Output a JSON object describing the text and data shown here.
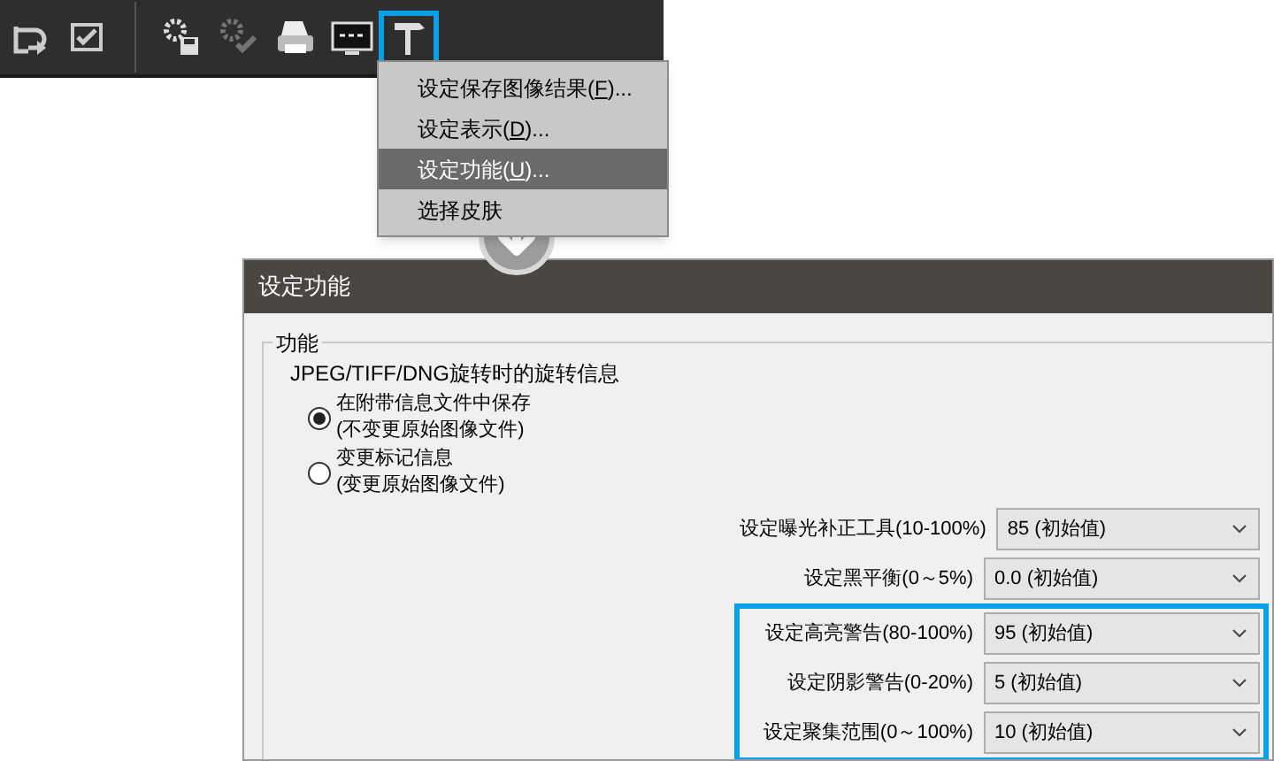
{
  "toolbar": {
    "items": [
      {
        "kind": "rotate",
        "disabled": false
      },
      {
        "kind": "check",
        "disabled": false
      },
      {
        "kind": "divider"
      },
      {
        "kind": "gear-save",
        "disabled": false
      },
      {
        "kind": "gear-check",
        "disabled": true
      },
      {
        "kind": "printer",
        "disabled": false
      },
      {
        "kind": "monitor",
        "disabled": false
      }
    ],
    "framed_items": [
      {
        "kind": "hammer",
        "disabled": false
      }
    ]
  },
  "menu": {
    "items": [
      {
        "before": "设定保存图像结果(",
        "mnemonic": "F",
        "after": ")...",
        "selected": false
      },
      {
        "before": "设定表示(",
        "mnemonic": "D",
        "after": ")...",
        "selected": false
      },
      {
        "before": "设定功能(",
        "mnemonic": "U",
        "after": ")...",
        "selected": true
      },
      {
        "before": "选择皮肤",
        "selected": false
      }
    ]
  },
  "dialog": {
    "title": "设定功能",
    "group": {
      "label": "功能",
      "heading": "JPEG/TIFF/DNG旋转时的旋转信息",
      "options": [
        {
          "line1": "在附带信息文件中保存",
          "line2": "(不变更原始图像文件)",
          "selected": true
        },
        {
          "line1": "变更标记信息",
          "line2": "(变更原始图像文件)",
          "selected": false
        }
      ]
    },
    "settings": [
      {
        "label": "设定曝光补正工具(10-100%)",
        "value": "85 (初始值)"
      },
      {
        "label": "设定黑平衡(0～5%)",
        "value": "0.0 (初始值)"
      }
    ],
    "highlighted_settings": [
      {
        "label": "设定高亮警告(80-100%)",
        "value": "95 (初始值)"
      },
      {
        "label": "设定阴影警告(0-20%)",
        "value": "5 (初始值)"
      },
      {
        "label": "设定聚集范围(0～100%)",
        "value": "10 (初始值)"
      }
    ]
  }
}
